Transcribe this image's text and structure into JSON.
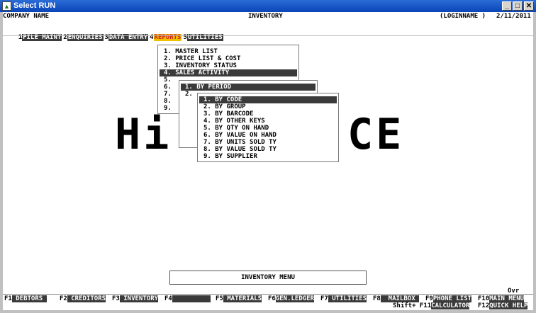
{
  "window": {
    "title": "Select RUN",
    "icon": "run-app-icon",
    "min": "_",
    "max": "□",
    "close": "✕"
  },
  "header": {
    "company": "COMPANY NAME",
    "module": "INVENTORY",
    "login": "(LOGINNAME )",
    "date": "2/11/2011"
  },
  "menubar": [
    {
      "num": "1",
      "label": "FILE MAINT"
    },
    {
      "num": "2",
      "label": "ENQUIRIES"
    },
    {
      "num": "3",
      "label": "DATA ENTRY"
    },
    {
      "num": "4",
      "label": "REPORTS",
      "active": true
    },
    {
      "num": "5",
      "label": "UTILITIES"
    }
  ],
  "reports_menu": [
    "1. MASTER LIST",
    "2. PRICE LIST & COST",
    "3. INVENTORY STATUS",
    "4. SALES ACTIVITY",
    "5.",
    "6.",
    "7.",
    "8.",
    "9."
  ],
  "sales_menu": [
    "1. BY PERIOD",
    "2."
  ],
  "period_menu": [
    "1. BY CODE",
    "2. BY GROUP",
    "3. BY BARCODE",
    "4. BY OTHER KEYS",
    "5. BY QTY ON HAND",
    "6. BY VALUE ON HAND",
    "7. BY UNITS SOLD TY",
    "8. BY VALUE SOLD TY",
    "9. BY SUPPLIER"
  ],
  "background_text_left": "Hi",
  "background_text_right": "CE",
  "footer_title": "INVENTORY MENU",
  "ovr": "Ovr",
  "fkeys": [
    {
      "key": "F1",
      "label": " DEBTORS "
    },
    {
      "key": "F2",
      "label": " CREDITORS"
    },
    {
      "key": "F3",
      "label": " INVENTORY"
    },
    {
      "key": "F4",
      "label": "          "
    },
    {
      "key": "F5",
      "label": " MATERIALS"
    },
    {
      "key": "F6",
      "label": "GEN.LEDGER"
    },
    {
      "key": "F7",
      "label": " UTILITIES"
    },
    {
      "key": "F8",
      "label": "  MAILBOX "
    },
    {
      "key": "F9",
      "label": "PHONE LIST"
    },
    {
      "key": "F10",
      "label": "MAIN MENU"
    }
  ],
  "fkeys2": [
    {
      "key": "Shift+ F11",
      "label": "CALCULATOR"
    },
    {
      "key": "F12",
      "label": "QUICK HELP"
    }
  ]
}
